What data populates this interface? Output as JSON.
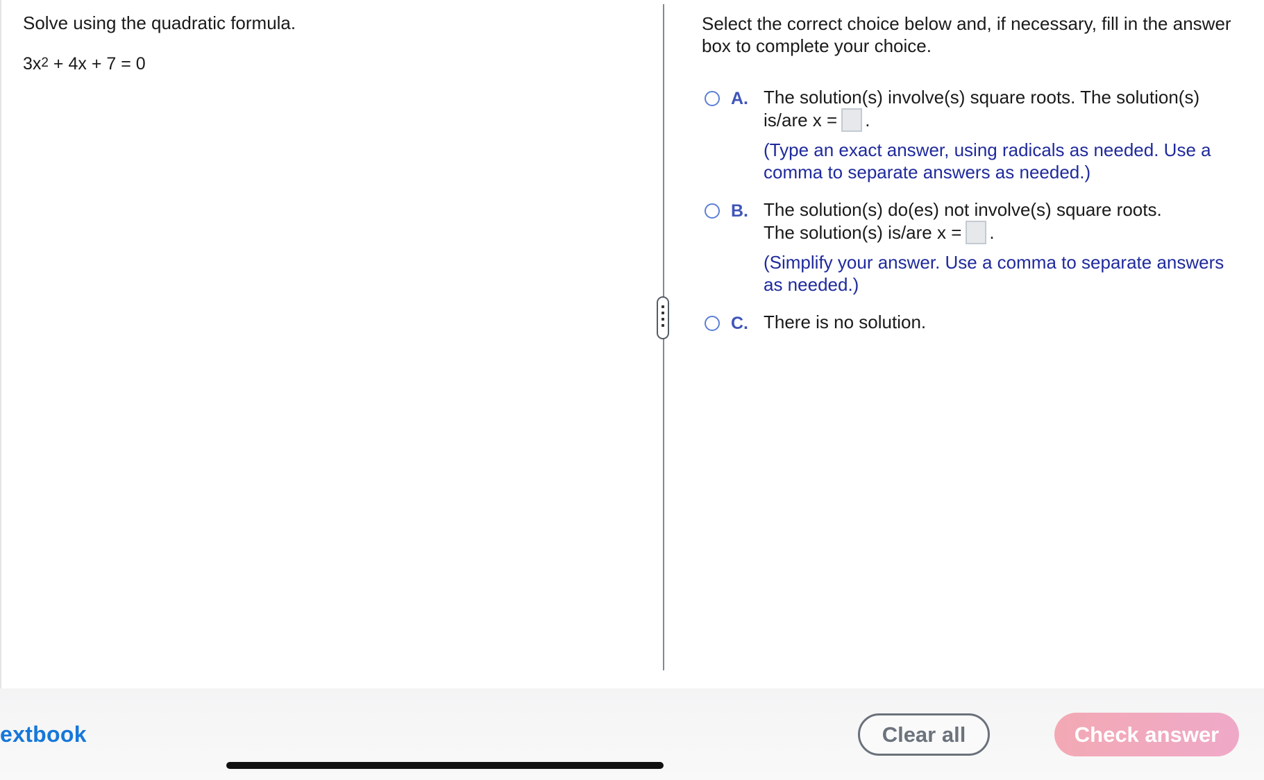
{
  "question": {
    "title": "Solve using the quadratic formula.",
    "equation": {
      "coef": "3x",
      "exponent": "2",
      "rest": " + 4x + 7 = 0"
    }
  },
  "answer_panel": {
    "instructions": "Select the correct choice below and, if necessary, fill in the answer box to complete your choice.",
    "choices": [
      {
        "letter": "A.",
        "text_line1": "The solution(s) involve(s) square roots. The solution(s)",
        "text_line2_prefix": "is/are x =",
        "answer_value": "",
        "text_line2_suffix": ".",
        "hint": "(Type an exact answer, using radicals as needed. Use a comma to separate answers as needed.)"
      },
      {
        "letter": "B.",
        "text_line1": "The solution(s) do(es) not involve(s) square roots.",
        "text_line2_prefix": "The solution(s) is/are x =",
        "answer_value": "",
        "text_line2_suffix": ".",
        "hint": "(Simplify your answer. Use a comma to separate answers as needed.)"
      },
      {
        "letter": "C.",
        "text_line1": "There is no solution."
      }
    ]
  },
  "footer": {
    "textbook_label": "extbook",
    "clear_label": "Clear all",
    "check_label": "Check answer"
  },
  "colors": {
    "accent_blue": "#3f55b8",
    "hint_blue": "#1f2a9c",
    "link_blue": "#1677d9",
    "check_button_pink": "#f3a9b4"
  }
}
